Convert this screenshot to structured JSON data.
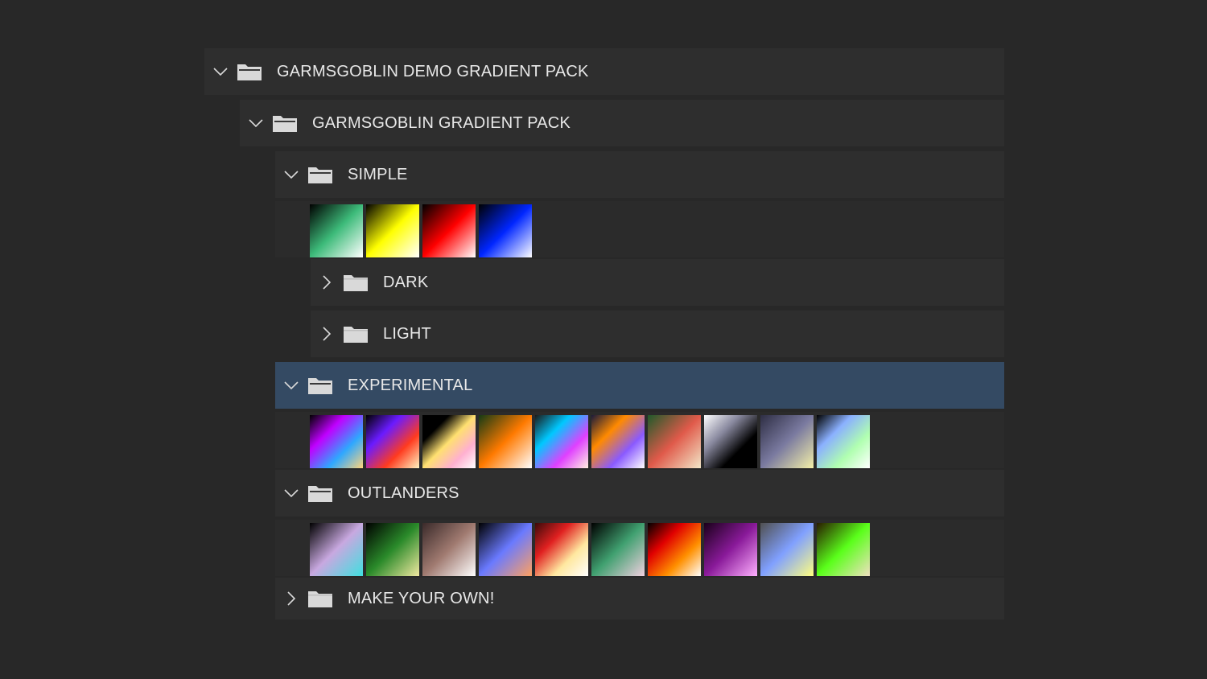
{
  "tree": {
    "root": {
      "label": "GARMSGOBLIN DEMO GRADIENT PACK",
      "expanded": true
    },
    "pack": {
      "label": "GARMSGOBLIN GRADIENT PACK",
      "expanded": true
    },
    "simple": {
      "label": "SIMPLE",
      "expanded": true,
      "swatches": [
        {
          "name": "simple-green",
          "stops": [
            "#000000",
            "#3dbb7a",
            "#ffffff"
          ]
        },
        {
          "name": "simple-yellow",
          "stops": [
            "#000000",
            "#ffff00",
            "#ffffff"
          ]
        },
        {
          "name": "simple-red",
          "stops": [
            "#000000",
            "#ff0000",
            "#ffffff"
          ]
        },
        {
          "name": "simple-blue",
          "stops": [
            "#000000",
            "#0026ff",
            "#ffffff"
          ]
        }
      ]
    },
    "dark": {
      "label": "DARK",
      "expanded": false
    },
    "light": {
      "label": "LIGHT",
      "expanded": false
    },
    "experimental": {
      "label": "EXPERIMENTAL",
      "expanded": true,
      "selected": true,
      "swatches": [
        {
          "name": "exp-1",
          "stops": [
            "#000000",
            "#c000ff",
            "#2ea8ff",
            "#ffd47a"
          ]
        },
        {
          "name": "exp-2",
          "stops": [
            "#000000",
            "#6a1bff",
            "#ff3b1f",
            "#fff3c0"
          ]
        },
        {
          "name": "exp-3",
          "stops": [
            "#000000",
            "#000000",
            "#ffe070",
            "#ffb0d0",
            "#ffffff"
          ]
        },
        {
          "name": "exp-4",
          "stops": [
            "#143a14",
            "#ff7a00",
            "#ffffff"
          ]
        },
        {
          "name": "exp-5",
          "stops": [
            "#1a1a1a",
            "#00c8ff",
            "#e040ff",
            "#fff0e0"
          ]
        },
        {
          "name": "exp-6",
          "stops": [
            "#1a1a3a",
            "#ff8a00",
            "#8a5aff",
            "#ffffff"
          ]
        },
        {
          "name": "exp-7",
          "stops": [
            "#1f5a2a",
            "#e05a4a",
            "#f2e6c8"
          ]
        },
        {
          "name": "exp-8",
          "stops": [
            "#ffffff",
            "#8a8aa0",
            "#000000",
            "#000000"
          ]
        },
        {
          "name": "exp-9",
          "stops": [
            "#2e2e44",
            "#7a7aa0",
            "#f4f0a8"
          ]
        },
        {
          "name": "exp-10",
          "stops": [
            "#000000",
            "#8ab0ff",
            "#b0ffb0",
            "#ffffff"
          ]
        }
      ]
    },
    "outlanders": {
      "label": "OUTLANDERS",
      "expanded": true,
      "swatches": [
        {
          "name": "out-1",
          "stops": [
            "#000000",
            "#c8a8e0",
            "#40e0e0"
          ]
        },
        {
          "name": "out-2",
          "stops": [
            "#000000",
            "#2a8a2a",
            "#f0e8a0"
          ]
        },
        {
          "name": "out-3",
          "stops": [
            "#3a2a2a",
            "#a07a70",
            "#ffffff"
          ]
        },
        {
          "name": "out-4",
          "stops": [
            "#000000",
            "#6a7aff",
            "#ffa060"
          ]
        },
        {
          "name": "out-5",
          "stops": [
            "#3a0a0a",
            "#e02020",
            "#ffe8a0",
            "#ffffff"
          ]
        },
        {
          "name": "out-6",
          "stops": [
            "#000000",
            "#40a070",
            "#f0d0e0"
          ]
        },
        {
          "name": "out-7",
          "stops": [
            "#000000",
            "#e00000",
            "#ff9000",
            "#ffffff"
          ]
        },
        {
          "name": "out-8",
          "stops": [
            "#1a001a",
            "#8a1a9a",
            "#ffb0ff"
          ]
        },
        {
          "name": "out-9",
          "stops": [
            "#505050",
            "#80a0ff",
            "#ffff80"
          ]
        },
        {
          "name": "out-10",
          "stops": [
            "#2a1a00",
            "#5aff1a",
            "#f0e0c0"
          ]
        }
      ]
    },
    "make_your_own": {
      "label": "MAKE YOUR OWN!",
      "expanded": false
    }
  },
  "colors": {
    "background": "#282828",
    "row": "#2e2e2e",
    "selected_row": "#344a63",
    "text": "#e8e8e8",
    "icon": "#d9d9d9"
  }
}
